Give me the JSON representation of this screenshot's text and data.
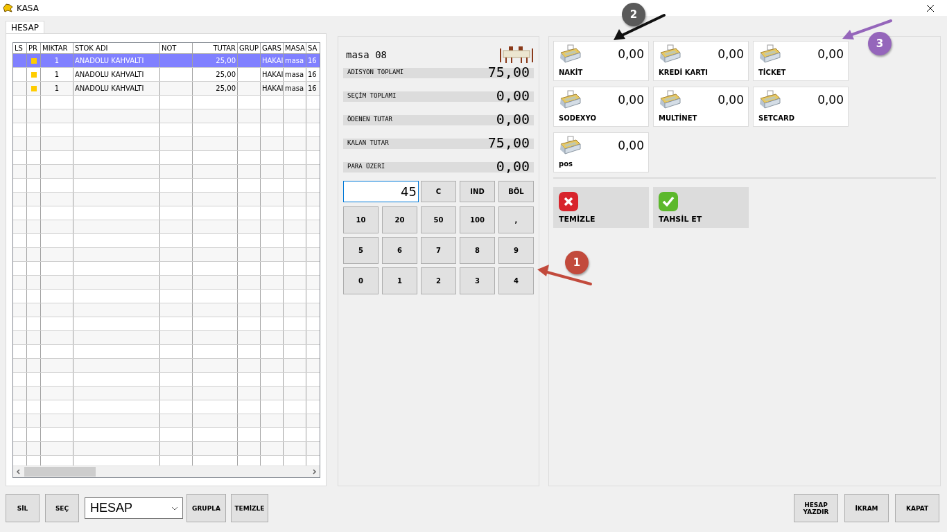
{
  "window": {
    "title": "KASA"
  },
  "tabs": [
    {
      "label": "HESAP",
      "selected": true
    }
  ],
  "grid": {
    "columns": [
      "LS",
      "PR",
      "MIKTAR",
      "STOK ADI",
      "NOT",
      "TUTAR",
      "GRUP",
      "GARS",
      "MASA",
      "SA"
    ],
    "rows": [
      {
        "selected": true,
        "flagged": true,
        "miktar": "1",
        "stok_adi": "ANADOLU KAHVALTI",
        "tutar": "25,00",
        "gars": "HAKAI",
        "masa": "masa",
        "sa": "16"
      },
      {
        "selected": false,
        "flagged": true,
        "miktar": "1",
        "stok_adi": "ANADOLU KAHVALTI",
        "tutar": "25,00",
        "gars": "HAKAI",
        "masa": "masa",
        "sa": "16"
      },
      {
        "selected": false,
        "flagged": true,
        "miktar": "1",
        "stok_adi": "ANADOLU KAHVALTI",
        "tutar": "25,00",
        "gars": "HAKAI",
        "masa": "masa",
        "sa": "16"
      }
    ]
  },
  "summary": {
    "table_name": "masa 08",
    "rows": [
      {
        "label": "ADISYON TOPLAMI",
        "value": "75,00"
      },
      {
        "label": "SEÇİM TOPLAMI",
        "value": "0,00"
      },
      {
        "label": "ÖDENEN TUTAR",
        "value": "0,00"
      },
      {
        "label": "KALAN TUTAR",
        "value": "75,00"
      },
      {
        "label": "PARA ÜZERİ",
        "value": "0,00"
      }
    ]
  },
  "keypad": {
    "display": "45",
    "top_keys": [
      "C",
      "IND",
      "BÖL"
    ],
    "keys": [
      "10",
      "20",
      "50",
      "100",
      ",",
      "5",
      "6",
      "7",
      "8",
      "9",
      "0",
      "1",
      "2",
      "3",
      "4"
    ]
  },
  "payments": [
    {
      "name": "NAKİT",
      "amount": "0,00"
    },
    {
      "name": "KREDİ KARTI",
      "amount": "0,00"
    },
    {
      "name": "TİCKET",
      "amount": "0,00"
    },
    {
      "name": "SODEXYO",
      "amount": "0,00"
    },
    {
      "name": "MULTİNET",
      "amount": "0,00"
    },
    {
      "name": "SETCARD",
      "amount": "0,00"
    },
    {
      "name": "pos",
      "amount": "0,00"
    }
  ],
  "actions": [
    {
      "label": "TEMİZLE",
      "kind": "clear"
    },
    {
      "label": "TAHSİL ET",
      "kind": "collect"
    }
  ],
  "bottom_left": {
    "buttons": [
      "SİL",
      "SEÇ"
    ],
    "dropdown": "HESAP",
    "more_buttons": [
      "GRUPLA",
      "TEMİZLE"
    ]
  },
  "bottom_right": {
    "buttons": [
      "HESAP YAZDIR",
      "İKRAM",
      "KAPAT"
    ]
  },
  "annotations": [
    {
      "label": "1",
      "color": "#c24a3c"
    },
    {
      "label": "2",
      "color": "#5a5a5a"
    },
    {
      "label": "3",
      "color": "#9566bb"
    }
  ]
}
